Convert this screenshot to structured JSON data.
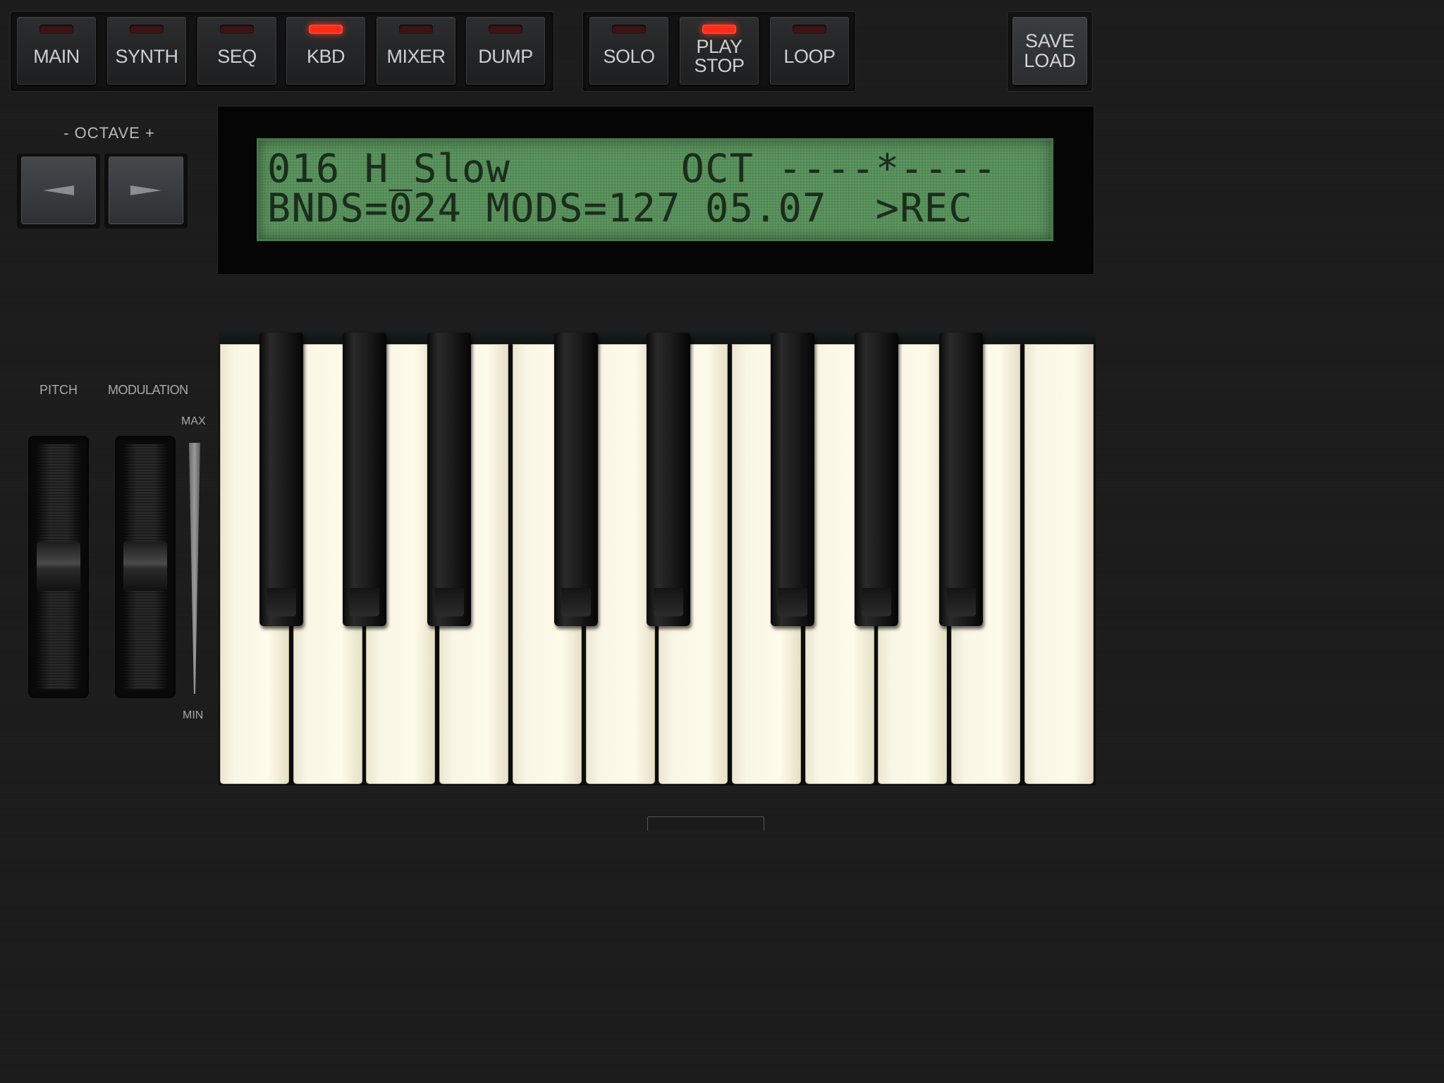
{
  "toolbar": {
    "group1": [
      {
        "label": "MAIN",
        "led_on": false
      },
      {
        "label": "SYNTH",
        "led_on": false
      },
      {
        "label": "SEQ",
        "led_on": false
      },
      {
        "label": "KBD",
        "led_on": true
      },
      {
        "label": "MIXER",
        "led_on": false
      },
      {
        "label": "DUMP",
        "led_on": false
      }
    ],
    "group2": [
      {
        "label": "SOLO",
        "led_on": false
      },
      {
        "label_line1": "PLAY",
        "label_line2": "STOP",
        "led_on": true
      },
      {
        "label": "LOOP",
        "led_on": false
      }
    ],
    "save_load": {
      "line1": "SAVE",
      "line2": "LOAD"
    }
  },
  "octave": {
    "label": "- OCTAVE +",
    "down_icon": "left-triangle-icon",
    "up_icon": "right-triangle-icon"
  },
  "lcd": {
    "line1": "016 H_Slow       OCT ----*----",
    "line2": "BNDS=024 MODS=127 05.07  >REC"
  },
  "wheels": {
    "pitch_label": "PITCH",
    "modulation_label": "MODULATION",
    "max_label": "MAX",
    "min_label": "MIN"
  },
  "keyboard": {
    "white_key_count": 12,
    "black_key_count": 8
  },
  "colors": {
    "led_on": "#ff2a18",
    "led_off": "#3c1414",
    "lcd_background": "#5c9760",
    "lcd_text": "#1b2c1c",
    "white_key": "#fffbea",
    "black_key": "#1a1a1a"
  }
}
